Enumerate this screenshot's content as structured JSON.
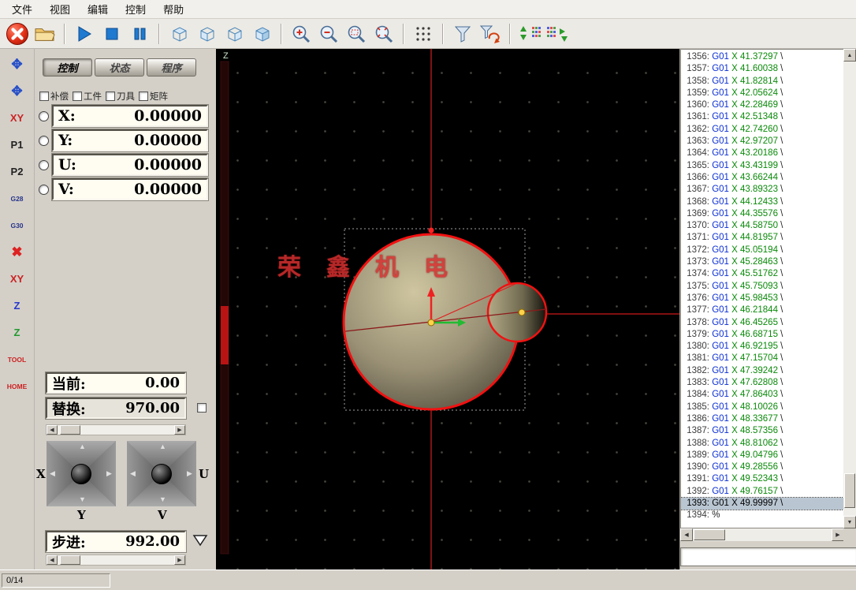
{
  "window": {
    "statusbar_counter": "0/14"
  },
  "menu": {
    "items": [
      "文件",
      "视图",
      "编辑",
      "控制",
      "帮助"
    ]
  },
  "toolbar": {
    "icons": [
      "stop-machine",
      "open-file",
      "run",
      "stop-run",
      "pause",
      "view-cube-top",
      "view-cube-left",
      "view-cube-right",
      "view-cube-iso",
      "zoom-in",
      "zoom-out",
      "zoom-window",
      "zoom-extents",
      "points-display",
      "filter",
      "filter-reset",
      "step-forward",
      "step-mode"
    ]
  },
  "sidebar": {
    "items": [
      {
        "name": "jog-move",
        "label": "✥",
        "color": "#2850c8"
      },
      {
        "name": "jog-move-plus",
        "label": "✥",
        "color": "#2850c8"
      },
      {
        "name": "xy-zero",
        "label": "XY",
        "color": "#cc2222"
      },
      {
        "name": "p1",
        "label": "P1",
        "color": "#222222"
      },
      {
        "name": "p2",
        "label": "P2",
        "color": "#222222"
      },
      {
        "name": "g28",
        "label": "G28",
        "color": "#28348a"
      },
      {
        "name": "g30",
        "label": "G30",
        "color": "#28348a"
      },
      {
        "name": "delete",
        "label": "✖",
        "color": "#dd2222"
      },
      {
        "name": "xy-clear",
        "label": "XY",
        "color": "#cc2222"
      },
      {
        "name": "z-up",
        "label": "Z",
        "color": "#2838cc"
      },
      {
        "name": "z-down",
        "label": "Z",
        "color": "#22992f"
      },
      {
        "name": "tool",
        "label": "TOOL",
        "color": "#cc2222"
      },
      {
        "name": "home",
        "label": "HOME",
        "color": "#cc2222"
      }
    ]
  },
  "control": {
    "tabs": [
      {
        "label": "控制",
        "active": true
      },
      {
        "label": "状态",
        "active": false
      },
      {
        "label": "程序",
        "active": false
      }
    ],
    "checkboxes": [
      "补偿",
      "工件",
      "刀具",
      "矩阵"
    ],
    "axes": [
      {
        "label": "X:",
        "value": "0.00000"
      },
      {
        "label": "Y:",
        "value": "0.00000"
      },
      {
        "label": "U:",
        "value": "0.00000"
      },
      {
        "label": "V:",
        "value": "0.00000"
      }
    ],
    "current_label": "当前:",
    "current_value": "0.00",
    "replace_label": "替换:",
    "replace_value": "970.00",
    "step_label": "步进:",
    "step_value": "992.00",
    "jog_labels": {
      "x": "X",
      "y": "Y",
      "u": "U",
      "v": "V"
    }
  },
  "canvas": {
    "z_axis_label": "Z",
    "watermark": "荣鑫机电",
    "colors": {
      "crosshair_red": "#ff2020",
      "cone_khaki": "#9a9176",
      "outline_red": "#f11111"
    }
  },
  "gcode": {
    "selected_num": 1393,
    "lines": [
      {
        "num": 1356,
        "cmd": "G01",
        "arg": "X 41.37297",
        "tail": "\\"
      },
      {
        "num": 1357,
        "cmd": "G01",
        "arg": "X 41.60038",
        "tail": "\\"
      },
      {
        "num": 1358,
        "cmd": "G01",
        "arg": "X 41.82814",
        "tail": "\\"
      },
      {
        "num": 1359,
        "cmd": "G01",
        "arg": "X 42.05624",
        "tail": "\\"
      },
      {
        "num": 1360,
        "cmd": "G01",
        "arg": "X 42.28469",
        "tail": "\\"
      },
      {
        "num": 1361,
        "cmd": "G01",
        "arg": "X 42.51348",
        "tail": "\\"
      },
      {
        "num": 1362,
        "cmd": "G01",
        "arg": "X 42.74260",
        "tail": "\\"
      },
      {
        "num": 1363,
        "cmd": "G01",
        "arg": "X 42.97207",
        "tail": "\\"
      },
      {
        "num": 1364,
        "cmd": "G01",
        "arg": "X 43.20186",
        "tail": "\\"
      },
      {
        "num": 1365,
        "cmd": "G01",
        "arg": "X 43.43199",
        "tail": "\\"
      },
      {
        "num": 1366,
        "cmd": "G01",
        "arg": "X 43.66244",
        "tail": "\\"
      },
      {
        "num": 1367,
        "cmd": "G01",
        "arg": "X 43.89323",
        "tail": "\\"
      },
      {
        "num": 1368,
        "cmd": "G01",
        "arg": "X 44.12433",
        "tail": "\\"
      },
      {
        "num": 1369,
        "cmd": "G01",
        "arg": "X 44.35576",
        "tail": "\\"
      },
      {
        "num": 1370,
        "cmd": "G01",
        "arg": "X 44.58750",
        "tail": "\\"
      },
      {
        "num": 1371,
        "cmd": "G01",
        "arg": "X 44.81957",
        "tail": "\\"
      },
      {
        "num": 1372,
        "cmd": "G01",
        "arg": "X 45.05194",
        "tail": "\\"
      },
      {
        "num": 1373,
        "cmd": "G01",
        "arg": "X 45.28463",
        "tail": "\\"
      },
      {
        "num": 1374,
        "cmd": "G01",
        "arg": "X 45.51762",
        "tail": "\\"
      },
      {
        "num": 1375,
        "cmd": "G01",
        "arg": "X 45.75093",
        "tail": "\\"
      },
      {
        "num": 1376,
        "cmd": "G01",
        "arg": "X 45.98453",
        "tail": "\\"
      },
      {
        "num": 1377,
        "cmd": "G01",
        "arg": "X 46.21844",
        "tail": "\\"
      },
      {
        "num": 1378,
        "cmd": "G01",
        "arg": "X 46.45265",
        "tail": "\\"
      },
      {
        "num": 1379,
        "cmd": "G01",
        "arg": "X 46.68715",
        "tail": "\\"
      },
      {
        "num": 1380,
        "cmd": "G01",
        "arg": "X 46.92195",
        "tail": "\\"
      },
      {
        "num": 1381,
        "cmd": "G01",
        "arg": "X 47.15704",
        "tail": "\\"
      },
      {
        "num": 1382,
        "cmd": "G01",
        "arg": "X 47.39242",
        "tail": "\\"
      },
      {
        "num": 1383,
        "cmd": "G01",
        "arg": "X 47.62808",
        "tail": "\\"
      },
      {
        "num": 1384,
        "cmd": "G01",
        "arg": "X 47.86403",
        "tail": "\\"
      },
      {
        "num": 1385,
        "cmd": "G01",
        "arg": "X 48.10026",
        "tail": "\\"
      },
      {
        "num": 1386,
        "cmd": "G01",
        "arg": "X 48.33677",
        "tail": "\\"
      },
      {
        "num": 1387,
        "cmd": "G01",
        "arg": "X 48.57356",
        "tail": "\\"
      },
      {
        "num": 1388,
        "cmd": "G01",
        "arg": "X 48.81062",
        "tail": "\\"
      },
      {
        "num": 1389,
        "cmd": "G01",
        "arg": "X 49.04796",
        "tail": "\\"
      },
      {
        "num": 1390,
        "cmd": "G01",
        "arg": "X 49.28556",
        "tail": "\\"
      },
      {
        "num": 1391,
        "cmd": "G01",
        "arg": "X 49.52343",
        "tail": "\\"
      },
      {
        "num": 1392,
        "cmd": "G01",
        "arg": "X 49.76157",
        "tail": "\\"
      },
      {
        "num": 1393,
        "cmd": "G01",
        "arg": "X 49.99997",
        "tail": "\\"
      },
      {
        "num": 1394,
        "plain": "%"
      }
    ]
  }
}
